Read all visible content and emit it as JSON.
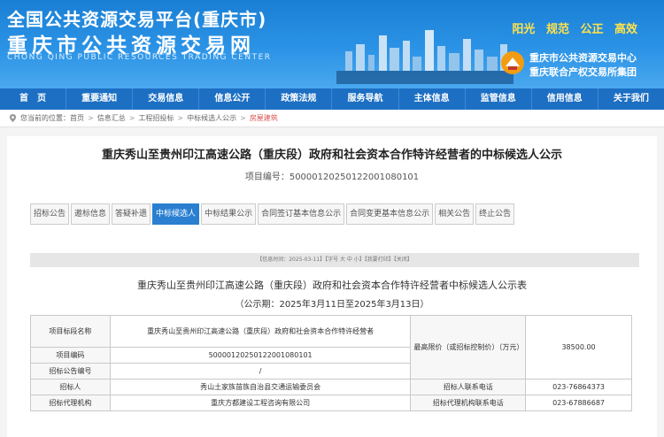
{
  "header": {
    "title_cn": "全国公共资源交易平台(重庆市)",
    "title_city": "重庆市公共资源交易网",
    "title_en": "CHONG QING PUBLIC RESOURCES TRADING CENTER",
    "slogan": "阳光 规范 公正 高效",
    "org_line1": "重庆市公共资源交易中心",
    "org_line2": "重庆联合产权交易所集团"
  },
  "nav": [
    "首　页",
    "重要通知",
    "交易信息",
    "信息公开",
    "政策法规",
    "服务导航",
    "主体信息",
    "监管信息",
    "信用信息",
    "关于我们"
  ],
  "breadcrumb": {
    "prefix": "您当前的位置：",
    "items": [
      "首页",
      "信息汇总",
      "工程招投标",
      "中标候选人公示"
    ],
    "current": "房屋建筑"
  },
  "notice": {
    "title": "重庆秀山至贵州印江高速公路（重庆段）政府和社会资本合作特许经营者的中标候选人公示",
    "project_code": "项目编号：500001202501220010801​01"
  },
  "tabs": [
    "招标公告",
    "邀标信息",
    "答疑补遗",
    "中标候选人",
    "中标结果公示",
    "合同签订基本信息公示",
    "合同变更基本信息公示",
    "相关公告",
    "终止公告"
  ],
  "active_tab": 3,
  "toolbar": "【信息时间：2025-03-11】【字号 大 中 小】【我要打印】【关闭】",
  "table_title": "重庆秀山至贵州印江高速公路（重庆段）政府和社会资本合作特许经营者中标候选人公示表",
  "period": "（公示期：2025年3月11日至2025年3月13日）",
  "table": {
    "project_name_label": "项目标段名称",
    "project_name": "重庆秀山至贵州印江高速公路（重庆段）政府和社会资本合作特许经营者",
    "max_price_label": "最高限价（或招标控制价）（万元）",
    "max_price": "38500.00",
    "project_code_label": "项目编码",
    "project_code": "500001202501220010801​01",
    "notice_code_label": "招标公告编号",
    "notice_code": "/",
    "tenderer_label": "招标人",
    "tenderer": "秀山土家族苗族自治县交通运输委员会",
    "tenderer_phone_label": "招标人联系电话",
    "tenderer_phone": "023-76864373",
    "agency_label": "招标代理机构",
    "agency": "重庆方都建设工程咨询有限公司",
    "agency_phone_label": "招标代理机构联系电话",
    "agency_phone": "023-67886687"
  }
}
